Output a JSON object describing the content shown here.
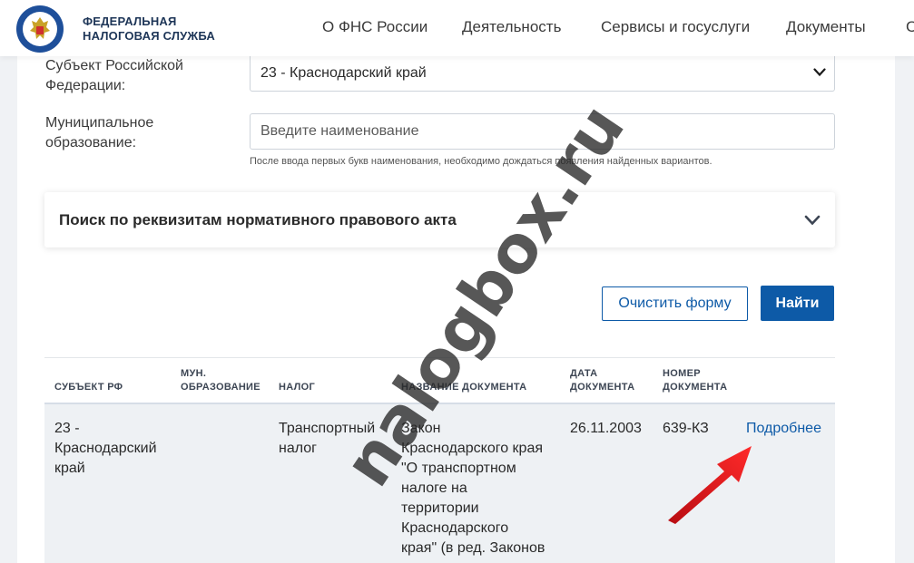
{
  "header": {
    "logo_line1": "ФЕДЕРАЛЬНАЯ",
    "logo_line2": "НАЛОГОВАЯ СЛУЖБА",
    "emblem_text": "ФЕДЕРАЛЬНАЯ НАЛОГОВАЯ СЛУЖБА",
    "nav": [
      "О ФНС России",
      "Деятельность",
      "Сервисы и госуслуги",
      "Документы",
      "С"
    ]
  },
  "form": {
    "region_label_1": "Субъект Российской",
    "region_label_2": "Федерации:",
    "region_value": "23 - Краснодарский край",
    "municipal_label_1": "Муниципальное",
    "municipal_label_2": "образование:",
    "municipal_placeholder": "Введите наименование",
    "municipal_hint": "После ввода первых букв наименования, необходимо дождаться появления найденных вариантов.",
    "accordion_title": "Поиск по реквизитам нормативного правового акта",
    "clear_label": "Очистить форму",
    "find_label": "Найти"
  },
  "table": {
    "headers": {
      "subject": "СУБЪЕКТ РФ",
      "mun_1": "МУН.",
      "mun_2": "ОБРАЗОВАНИЕ",
      "tax": "НАЛОГ",
      "doc_name": "НАЗВАНИЕ ДОКУМЕНТА",
      "date_1": "ДАТА",
      "date_2": "ДОКУМЕНТА",
      "number_1": "НОМЕР",
      "number_2": "ДОКУМЕНТА"
    },
    "row": {
      "subject": [
        "23 -",
        "Краснодарский",
        "край"
      ],
      "tax": [
        "Транспортный",
        "налог"
      ],
      "doc_name": [
        "Закон",
        "Краснодарского края",
        "\"О транспортном",
        "налоге на",
        "территории",
        "Краснодарского",
        "края\" (в ред. Законов"
      ],
      "date": "26.11.2003",
      "number": "639-КЗ",
      "details": "Подробнее"
    }
  },
  "watermark": "nalogbox.ru",
  "colors": {
    "accent": "#0d5aa7",
    "arrow": "#e8141b",
    "row_bg": "#eef1f4"
  }
}
